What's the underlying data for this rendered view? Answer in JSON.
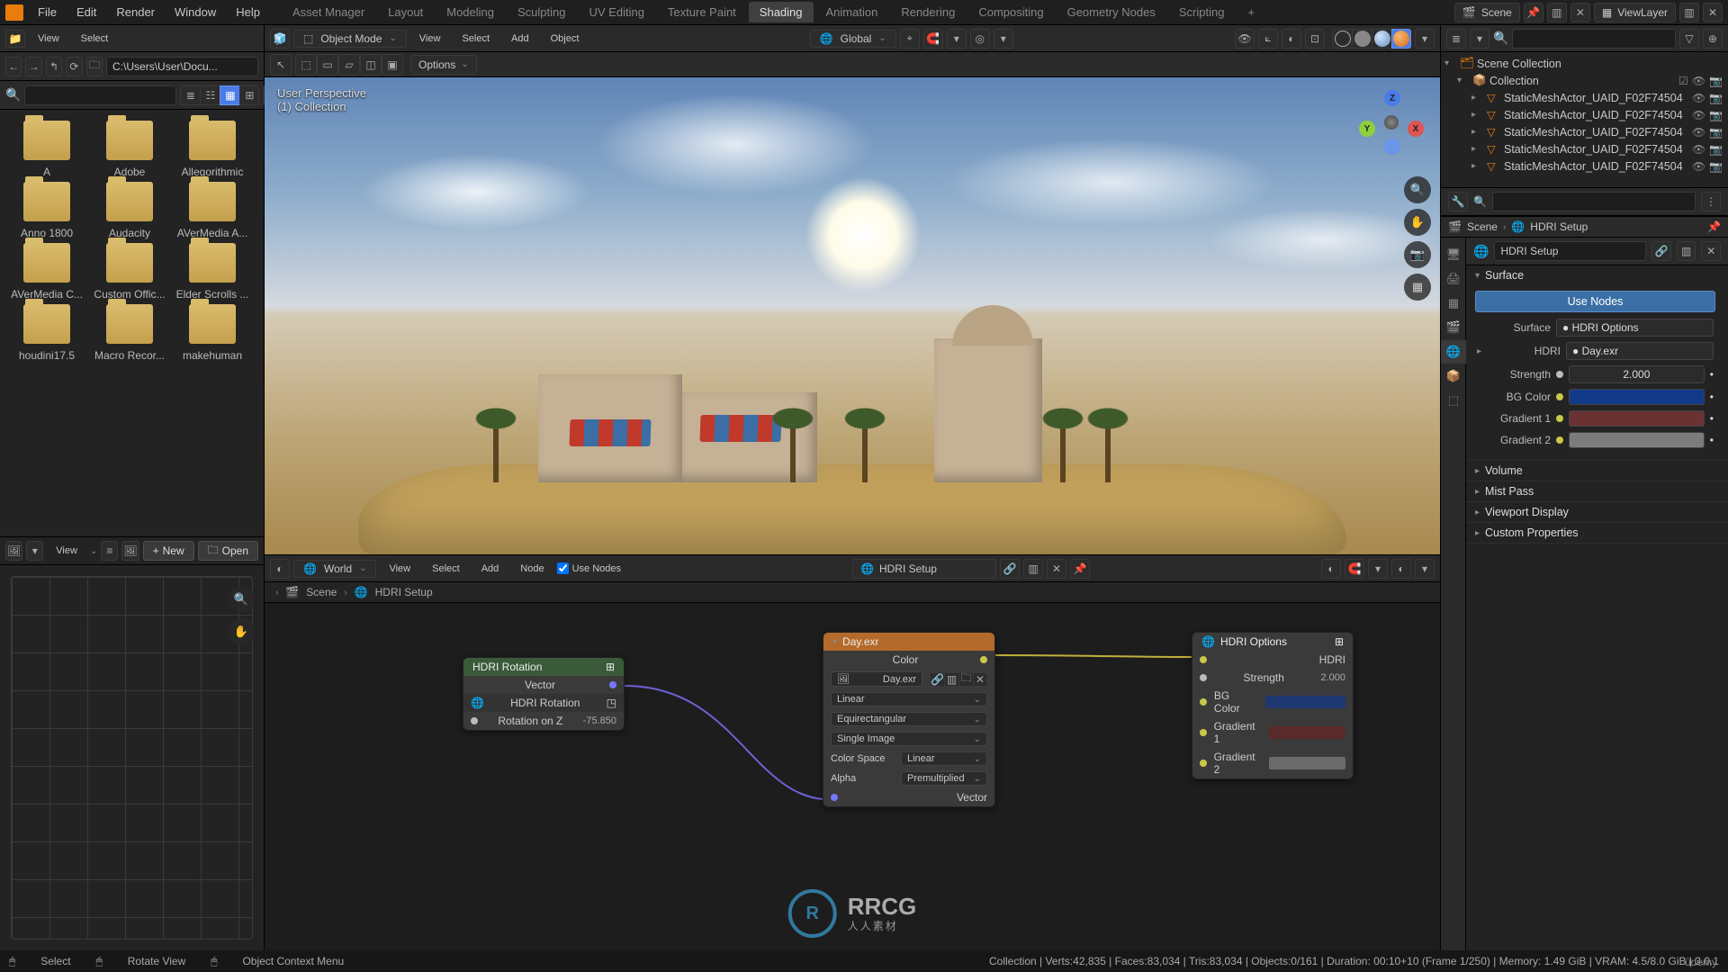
{
  "topmenu": {
    "items": [
      "File",
      "Edit",
      "Render",
      "Window",
      "Help"
    ]
  },
  "workspaces": {
    "tabs": [
      "Asset Mnager",
      "Layout",
      "Modeling",
      "Sculpting",
      "UV Editing",
      "Texture Paint",
      "Shading",
      "Animation",
      "Rendering",
      "Compositing",
      "Geometry Nodes",
      "Scripting"
    ],
    "active": "Shading",
    "add": "+"
  },
  "top_right": {
    "scene": "Scene",
    "viewlayer": "ViewLayer"
  },
  "filebrowser": {
    "menu_view": "View",
    "menu_select": "Select",
    "path": "C:\\Users\\User\\Docu...",
    "folders": [
      "A",
      "Adobe",
      "Allegorithmic",
      "Anno 1800",
      "Audacity",
      "AVerMedia A...",
      "AVerMedia C...",
      "Custom Offic...",
      "Elder Scrolls ...",
      "houdini17.5",
      "Macro Recor...",
      "makehuman"
    ]
  },
  "image_editor": {
    "menu_view": "View",
    "btn_new": "New",
    "btn_open": "Open"
  },
  "viewport": {
    "mode": "Object Mode",
    "menu_view": "View",
    "menu_select": "Select",
    "menu_add": "Add",
    "menu_object": "Object",
    "transform_orientation": "Global",
    "overlay_label": "Options",
    "info_line1": "User Perspective",
    "info_line2": "(1) Collection",
    "gizmo": {
      "x": "X",
      "y": "Y",
      "z": "Z"
    }
  },
  "nodeeditor": {
    "shader_type": "World",
    "menu_view": "View",
    "menu_select": "Select",
    "menu_add": "Add",
    "menu_node": "Node",
    "use_nodes": "Use Nodes",
    "slot_name": "HDRI Setup",
    "breadcrumb": {
      "scene": "Scene",
      "world": "HDRI Setup"
    },
    "nodes": {
      "rotation": {
        "title": "HDRI Rotation",
        "sub": "HDRI Rotation",
        "out": "Vector",
        "label_rot": "Rotation on Z",
        "val_rot": "-75.850"
      },
      "env": {
        "title": "Day.exr",
        "out_color": "Color",
        "image_field": "Day.exr",
        "interp": "Linear",
        "projection": "Equirectangular",
        "single_image": "Single Image",
        "colorspace_label": "Color Space",
        "colorspace": "Linear",
        "alpha_label": "Alpha",
        "alpha": "Premultiplied",
        "in_vector": "Vector"
      },
      "hdri_opts": {
        "title": "HDRI Options",
        "in_hdri": "HDRI",
        "strength_label": "Strength",
        "strength_val": "2.000",
        "bg_label": "BG Color",
        "grad1_label": "Gradient 1",
        "grad2_label": "Gradient 2"
      }
    }
  },
  "outliner": {
    "root": "Scene Collection",
    "collection": "Collection",
    "items": [
      "StaticMeshActor_UAID_F02F74504",
      "StaticMeshActor_UAID_F02F74504",
      "StaticMeshActor_UAID_F02F74504",
      "StaticMeshActor_UAID_F02F74504",
      "StaticMeshActor_UAID_F02F74504"
    ]
  },
  "breadcrumb2": {
    "scene": "Scene",
    "sep": "›",
    "world": "HDRI Setup"
  },
  "world_props": {
    "name": "HDRI Setup",
    "surface_head": "Surface",
    "use_nodes_btn": "Use Nodes",
    "surface_label": "Surface",
    "surface_value": "HDRI Options",
    "hdri_label": "HDRI",
    "hdri_value": "Day.exr",
    "strength_label": "Strength",
    "strength_value": "2.000",
    "bg_label": "BG Color",
    "grad1_label": "Gradient 1",
    "grad2_label": "Gradient 2",
    "volume_head": "Volume",
    "mist_head": "Mist Pass",
    "viewport_head": "Viewport Display",
    "custom_head": "Custom Properties"
  },
  "colors": {
    "bg": "#133a89",
    "grad1": "#6a3232",
    "grad2": "#7c7c7c"
  },
  "status": {
    "select": "Select",
    "rotate": "Rotate View",
    "context": "Object Context Menu",
    "right": "Collection | Verts:42,835 | Faces:83,034 | Tris:83,034 | Objects:0/161 | Duration: 00:10+10 (Frame 1/250) | Memory: 1.49 GiB | VRAM: 4.5/8.0 GiB | 3.0.1"
  },
  "watermark": {
    "logo": "R",
    "text": "RRCG",
    "sub": "人人素材"
  }
}
